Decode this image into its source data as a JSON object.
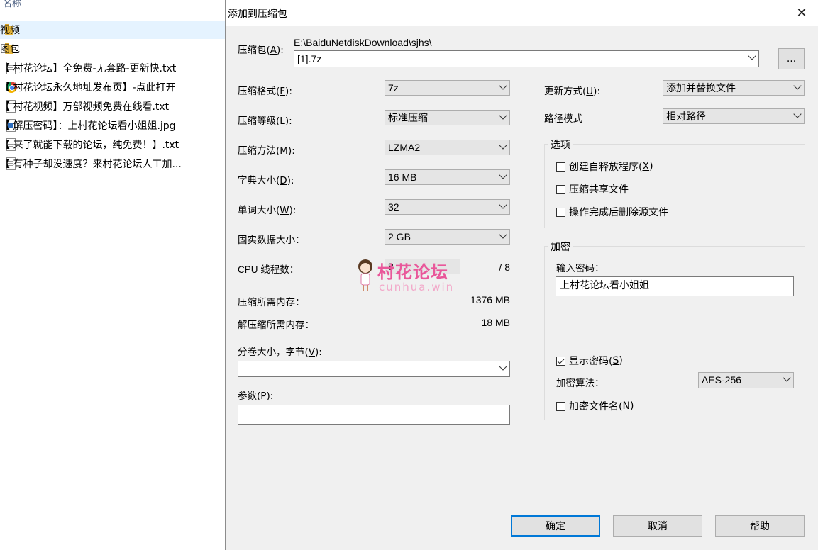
{
  "explorer": {
    "column_header": "名称",
    "files": [
      {
        "type": "folder",
        "name": "视频",
        "selected": true
      },
      {
        "type": "folder",
        "name": "图包",
        "selected": false
      },
      {
        "type": "txt",
        "name": "【 村花论坛】全免费-无套路-更新快.txt",
        "selected": false
      },
      {
        "type": "web",
        "name": "【 村花论坛永久地址发布页】-点此打开",
        "selected": false
      },
      {
        "type": "txt",
        "name": "【 村花视频】万部视频免费在线看.txt",
        "selected": false
      },
      {
        "type": "img",
        "name": "【 解压密码】：上村花论坛看小姐姐.jpg",
        "selected": false
      },
      {
        "type": "txt",
        "name": "【 来了就能下载的论坛，纯免费！】.txt",
        "selected": false
      },
      {
        "type": "txt",
        "name": "【 有种子却没速度？来村花论坛人工加...",
        "selected": false
      }
    ]
  },
  "dialog": {
    "title": "添加到压缩包",
    "close_glyph": "✕",
    "archive": {
      "label": "压缩包(",
      "label_key": "A",
      "label_end": "):",
      "path": "E:\\BaiduNetdiskDownload\\sjhs\\",
      "value": "[1].7z",
      "browse_label": "..."
    },
    "left": {
      "format": {
        "label": "压缩格式(",
        "key": "F",
        "end": "):",
        "value": "7z"
      },
      "level": {
        "label": "压缩等级(",
        "key": "L",
        "end": "):",
        "value": "标准压缩"
      },
      "method": {
        "label": "压缩方法(",
        "key": "M",
        "end": "):",
        "value": "LZMA2"
      },
      "dict": {
        "label": "字典大小(",
        "key": "D",
        "end": "):",
        "value": "16 MB"
      },
      "word": {
        "label": "单词大小(",
        "key": "W",
        "end": "):",
        "value": "32"
      },
      "solid": {
        "label": "固实数据大小：",
        "value": "2 GB"
      },
      "cpu": {
        "label": "CPU 线程数：",
        "value": "8",
        "total": "/ 8"
      },
      "mem_compress": {
        "label": "压缩所需内存：",
        "value": "1376 MB"
      },
      "mem_decompress": {
        "label": "解压缩所需内存：",
        "value": "18 MB"
      },
      "volume": {
        "label": "分卷大小，字节(",
        "key": "V",
        "end": "):",
        "value": ""
      },
      "params": {
        "label": "参数(",
        "key": "P",
        "end": "):",
        "value": ""
      }
    },
    "right": {
      "update": {
        "label": "更新方式(",
        "key": "U",
        "end": "):",
        "value": "添加并替换文件"
      },
      "path_mode": {
        "label": "路径模式",
        "value": "相对路径"
      },
      "options": {
        "title": "选项",
        "sfx": {
          "label": "创建自释放程序(",
          "key": "X",
          "end": ")",
          "checked": false
        },
        "shared": {
          "label": "压缩共享文件",
          "checked": false
        },
        "delete": {
          "label": "操作完成后删除源文件",
          "checked": false
        }
      },
      "encryption": {
        "title": "加密",
        "password_label": "输入密码：",
        "password_value": "上村花论坛看小姐姐",
        "show_password": {
          "label": "显示密码(",
          "key": "S",
          "end": ")",
          "checked": true
        },
        "method_label": "加密算法：",
        "method_value": "AES-256",
        "encrypt_names": {
          "label": "加密文件名(",
          "key": "N",
          "end": ")",
          "checked": false
        }
      }
    },
    "buttons": {
      "ok": "确定",
      "cancel": "取消",
      "help": "帮助"
    }
  },
  "watermark": {
    "main": "村花论坛",
    "sub": "cunhua.win"
  }
}
